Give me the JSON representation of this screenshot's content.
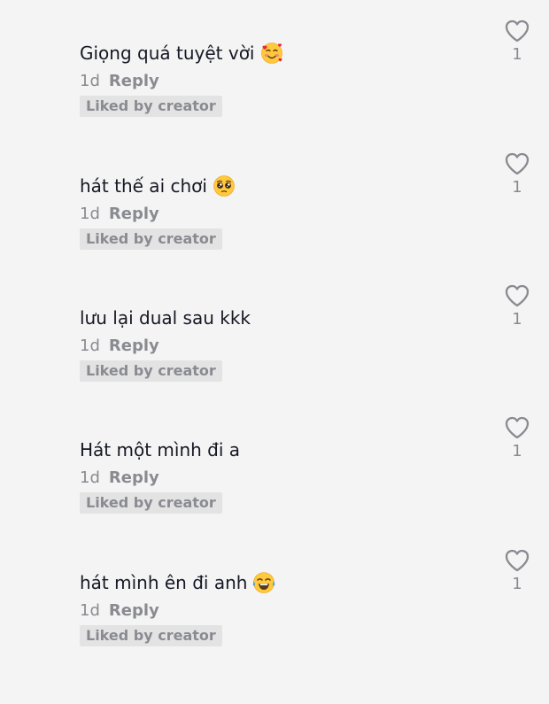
{
  "comments": [
    {
      "text": "Giọng quá tuyệt vời",
      "emoji": "smiling-face-with-hearts-icon",
      "time": "1d",
      "reply_label": "Reply",
      "badge": "Liked by creator",
      "likes": "1"
    },
    {
      "text": "hát thế ai chơi",
      "emoji": "pleading-face-icon",
      "time": "1d",
      "reply_label": "Reply",
      "badge": "Liked by creator",
      "likes": "1"
    },
    {
      "text": "lưu lại dual sau kkk",
      "emoji": null,
      "time": "1d",
      "reply_label": "Reply",
      "badge": "Liked by creator",
      "likes": "1"
    },
    {
      "text": "Hát một mình đi a",
      "emoji": null,
      "time": "1d",
      "reply_label": "Reply",
      "badge": "Liked by creator",
      "likes": "1"
    },
    {
      "text": "hát mình ên đi anh",
      "emoji": "face-with-tears-of-joy-icon",
      "time": "1d",
      "reply_label": "Reply",
      "badge": "Liked by creator",
      "likes": "1"
    }
  ],
  "colors": {
    "background": "#f4f4f4",
    "text_primary": "#161823",
    "text_secondary": "#8a8b91",
    "badge_background": "#e3e3e4"
  },
  "icons": {
    "like": "heart-outline-icon"
  }
}
